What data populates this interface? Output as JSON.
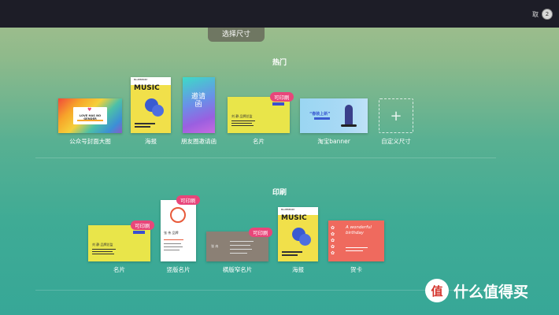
{
  "topbar": {
    "user_name": "取",
    "avatar_text": "2"
  },
  "size_tab": {
    "label": "选择尺寸"
  },
  "hot": {
    "title": "热门",
    "items": [
      {
        "label": "公众号封面大图",
        "thumb_text": "LOVE HAS NO GENDER"
      },
      {
        "label": "海报",
        "thumb_text": "MUSIC"
      },
      {
        "label": "朋友圈邀请函",
        "thumb_text": "邀请函"
      },
      {
        "label": "名片",
        "badge": "可印刷"
      },
      {
        "label": "淘宝banner",
        "thumb_text": "“春装上新”"
      },
      {
        "label": "自定义尺寸",
        "thumb_text": "+"
      }
    ]
  },
  "print": {
    "title": "印刷",
    "items": [
      {
        "label": "名片",
        "badge": "可印刷"
      },
      {
        "label": "竖版名片",
        "badge": "可印刷"
      },
      {
        "label": "横版窄名片",
        "badge": "可印刷"
      },
      {
        "label": "海报",
        "thumb_text": "MUSIC"
      },
      {
        "label": "贺卡",
        "thumb_text": "A wonderful birthday"
      }
    ]
  },
  "brand": {
    "text": "什么值得买",
    "mark": "值"
  }
}
